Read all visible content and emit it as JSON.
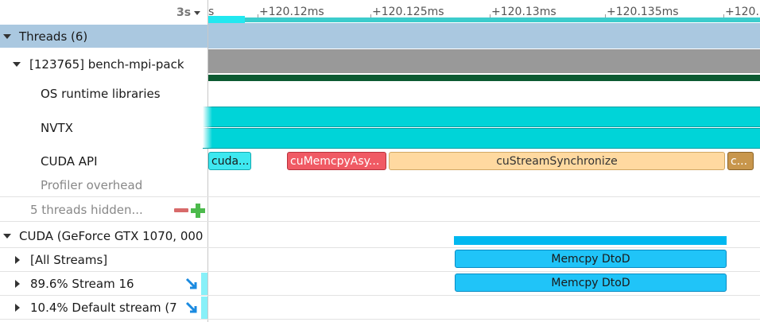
{
  "ruler": {
    "scale_label": "3s",
    "ticks": [
      "s",
      "+120.12ms",
      "+120.125ms",
      "+120.13ms",
      "+120.135ms",
      "+120."
    ]
  },
  "tree": {
    "threads_label": "Threads (6)",
    "process_label": "[123765] bench-mpi-pack",
    "os_runtime_label": "OS runtime libraries",
    "nvtx_label": "NVTX",
    "cuda_api_label": "CUDA API",
    "profiler_overhead_label": "Profiler overhead",
    "hidden_threads_label": "5 threads hidden...",
    "cuda_device_label": "CUDA (GeForce GTX 1070, 000",
    "all_streams_label": "[All Streams]",
    "stream16_label": "89.6% Stream 16",
    "default_stream_label": "10.4% Default stream (7"
  },
  "timeline": {
    "cuda_api_bars": [
      "cuda...",
      "cuMemcpyAsy...",
      "cuStreamSynchronize",
      "c..."
    ],
    "all_streams_bar": "Memcpy DtoD",
    "stream16_bar": "Memcpy DtoD"
  },
  "colors": {
    "threads_header_bg": "#aac8e0",
    "nvtx": "#00d4d8",
    "cuda_kernel": "#3ee8f0",
    "memcpy_async": "#f05a64",
    "stream_sync": "#ffd9a0",
    "small_call": "#c8964c",
    "memcpy_dtod": "#20c4f8",
    "dark_green": "#0d5a32"
  },
  "icons": [
    "dropdown-arrow-icon",
    "collapse-arrow-icon",
    "expand-arrow-icon",
    "remove-icon",
    "add-icon",
    "jump-to-icon"
  ]
}
